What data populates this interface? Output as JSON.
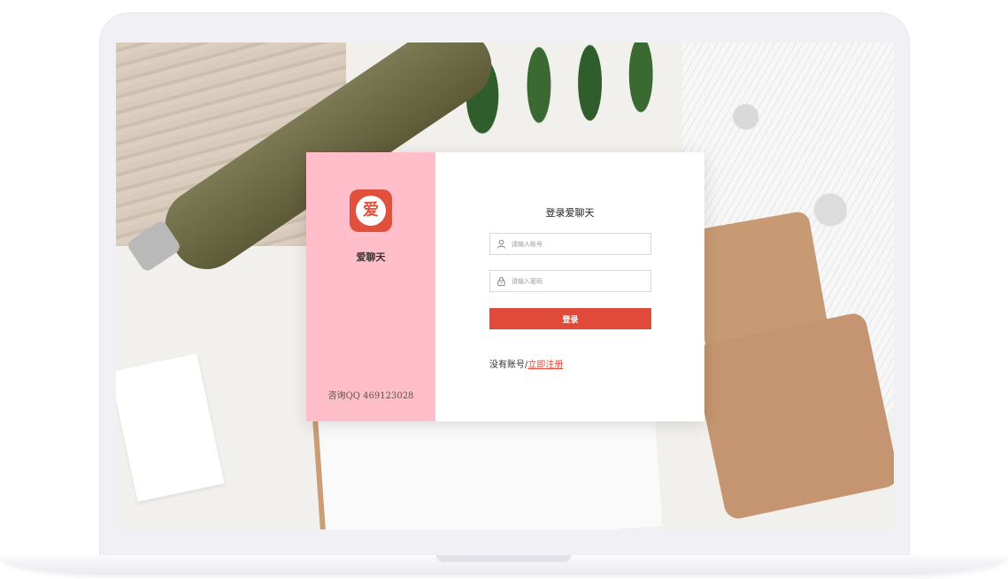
{
  "login": {
    "app_name": "爱聊天",
    "logo_glyph": "爱",
    "consult": "咨询QQ 469123028",
    "title": "登录爱聊天",
    "account_placeholder": "请输入账号",
    "password_placeholder": "请输入密码",
    "login_button": "登录",
    "register_prompt": "没有账号/",
    "register_link": "立即注册"
  },
  "icons": {
    "account": "user-icon",
    "password": "lock-icon"
  },
  "colors": {
    "accent": "#e04a3a",
    "sidebar": "#ffbec9",
    "logo": "#e0503c"
  }
}
